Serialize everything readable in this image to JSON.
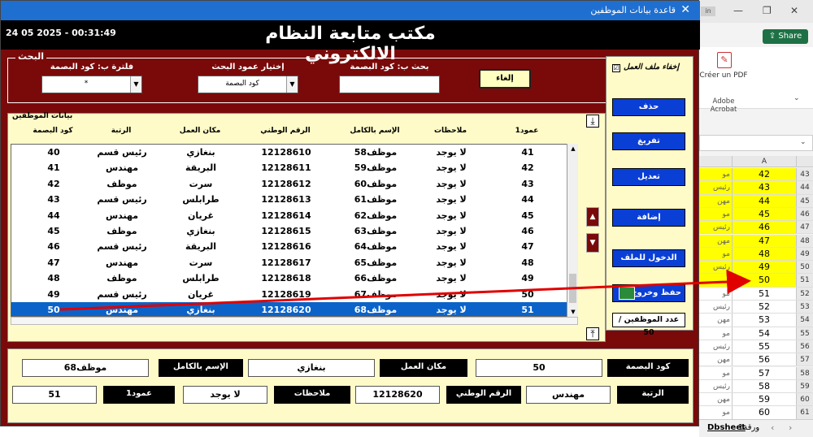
{
  "excel": {
    "tab_label": "in",
    "share": "Share",
    "pdf_label": "Créer un PDF",
    "acrobat_label": "Adobe Acrobat",
    "col_header": "A",
    "rows": [
      {
        "n": "43",
        "b": "مو",
        "a": "42",
        "yellow": true
      },
      {
        "n": "44",
        "b": "رئيس",
        "a": "43",
        "yellow": true
      },
      {
        "n": "45",
        "b": "مهن",
        "a": "44",
        "yellow": true
      },
      {
        "n": "46",
        "b": "مو",
        "a": "45",
        "yellow": true
      },
      {
        "n": "47",
        "b": "رئيس",
        "a": "46",
        "yellow": true
      },
      {
        "n": "48",
        "b": "مهن",
        "a": "47",
        "yellow": true
      },
      {
        "n": "49",
        "b": "مو",
        "a": "48",
        "yellow": true
      },
      {
        "n": "50",
        "b": "رئيس",
        "a": "49",
        "yellow": true
      },
      {
        "n": "51",
        "b": "",
        "a": "50",
        "yellow": true
      },
      {
        "n": "52",
        "b": "مو",
        "a": "51",
        "yellow": false
      },
      {
        "n": "53",
        "b": "رئيس",
        "a": "52",
        "yellow": false
      },
      {
        "n": "54",
        "b": "مهن",
        "a": "53",
        "yellow": false
      },
      {
        "n": "55",
        "b": "مو",
        "a": "54",
        "yellow": false
      },
      {
        "n": "56",
        "b": "رئيس",
        "a": "55",
        "yellow": false
      },
      {
        "n": "57",
        "b": "مهن",
        "a": "56",
        "yellow": false
      },
      {
        "n": "58",
        "b": "مو",
        "a": "57",
        "yellow": false
      },
      {
        "n": "59",
        "b": "رئيس",
        "a": "58",
        "yellow": false
      },
      {
        "n": "60",
        "b": "مهن",
        "a": "59",
        "yellow": false
      },
      {
        "n": "61",
        "b": "مو",
        "a": "60",
        "yellow": false
      }
    ],
    "sheet_tab": "ورقة1",
    "sheet_tab2": "Dbsheet"
  },
  "window": {
    "title": "قاعدة بيانات الموظفين",
    "app_title": "مكتب متابعة النظام الالكتروني",
    "datetime": "24 05 2025 - 00:31:49"
  },
  "search": {
    "legend": "البحث",
    "filter_label": "فلترة ب: كود البصمة",
    "filter_value": "*",
    "column_label": "إختيار عمود البحث",
    "column_value": "كود البصمة",
    "search_label": "بحث ب: كود البصمة",
    "search_value": "",
    "cancel": "إلغاء"
  },
  "grid": {
    "legend": "بيانات الموظفين",
    "headers": {
      "col1": "عمود1",
      "notes": "ملاحظات",
      "name": "الإسم بالكامل",
      "national": "الرقم الوطني",
      "work": "مكان العمل",
      "rank": "الرتبة",
      "code": "كود البصمة"
    },
    "rows": [
      {
        "col1": "41",
        "notes": "لا يوجد",
        "name": "موظف58",
        "national": "12128610",
        "work": "بنغازي",
        "rank": "رئيس قسم",
        "code": "40"
      },
      {
        "col1": "42",
        "notes": "لا يوجد",
        "name": "موظف59",
        "national": "12128611",
        "work": "البريقة",
        "rank": "مهندس",
        "code": "41"
      },
      {
        "col1": "43",
        "notes": "لا يوجد",
        "name": "موظف60",
        "national": "12128612",
        "work": "سرت",
        "rank": "موظف",
        "code": "42"
      },
      {
        "col1": "44",
        "notes": "لا يوجد",
        "name": "موظف61",
        "national": "12128613",
        "work": "طرابلس",
        "rank": "رئيس قسم",
        "code": "43"
      },
      {
        "col1": "45",
        "notes": "لا يوجد",
        "name": "موظف62",
        "national": "12128614",
        "work": "غريان",
        "rank": "مهندس",
        "code": "44"
      },
      {
        "col1": "46",
        "notes": "لا يوجد",
        "name": "موظف63",
        "national": "12128615",
        "work": "بنغازي",
        "rank": "موظف",
        "code": "45"
      },
      {
        "col1": "47",
        "notes": "لا يوجد",
        "name": "موظف64",
        "national": "12128616",
        "work": "البريقة",
        "rank": "رئيس قسم",
        "code": "46"
      },
      {
        "col1": "48",
        "notes": "لا يوجد",
        "name": "موظف65",
        "national": "12128617",
        "work": "سرت",
        "rank": "مهندس",
        "code": "47"
      },
      {
        "col1": "49",
        "notes": "لا يوجد",
        "name": "موظف66",
        "national": "12128618",
        "work": "طرابلس",
        "rank": "موظف",
        "code": "48"
      },
      {
        "col1": "50",
        "notes": "لا يوجد",
        "name": "موظف67",
        "national": "12128619",
        "work": "غريان",
        "rank": "رئيس قسم",
        "code": "49"
      },
      {
        "col1": "51",
        "notes": "لا يوجد",
        "name": "موظف68",
        "national": "12128620",
        "work": "بنغازي",
        "rank": "مهندس",
        "code": "50",
        "selected": true
      }
    ]
  },
  "side": {
    "hide_label": "إخفاء ملف العمل",
    "hide_checked": "☑",
    "buttons": [
      "حذف",
      "تفريغ",
      "تعديل",
      "إضافة",
      "الدخول للملف"
    ],
    "save": "حفظ وخروج",
    "count": "عدد الموظفين / 50"
  },
  "detail": {
    "code_label": "كود البصمة",
    "code_value": "50",
    "work_label": "مكان العمل",
    "work_value": "بنغازي",
    "name_label": "الإسم بالكامل",
    "name_value": "موظف68",
    "rank_label": "الرتبة",
    "rank_value": "مهندس",
    "national_label": "الرقم الوطني",
    "national_value": "12128620",
    "notes_label": "ملاحظات",
    "notes_value": "لا يوجد",
    "col1_label": "عمود1",
    "col1_value": "51"
  },
  "colors": {
    "accent": "#0a3fd6",
    "frame": "#7a0a0a",
    "panel": "#fffbc8",
    "selection": "#0b63c9",
    "arrow": "#e00000"
  }
}
